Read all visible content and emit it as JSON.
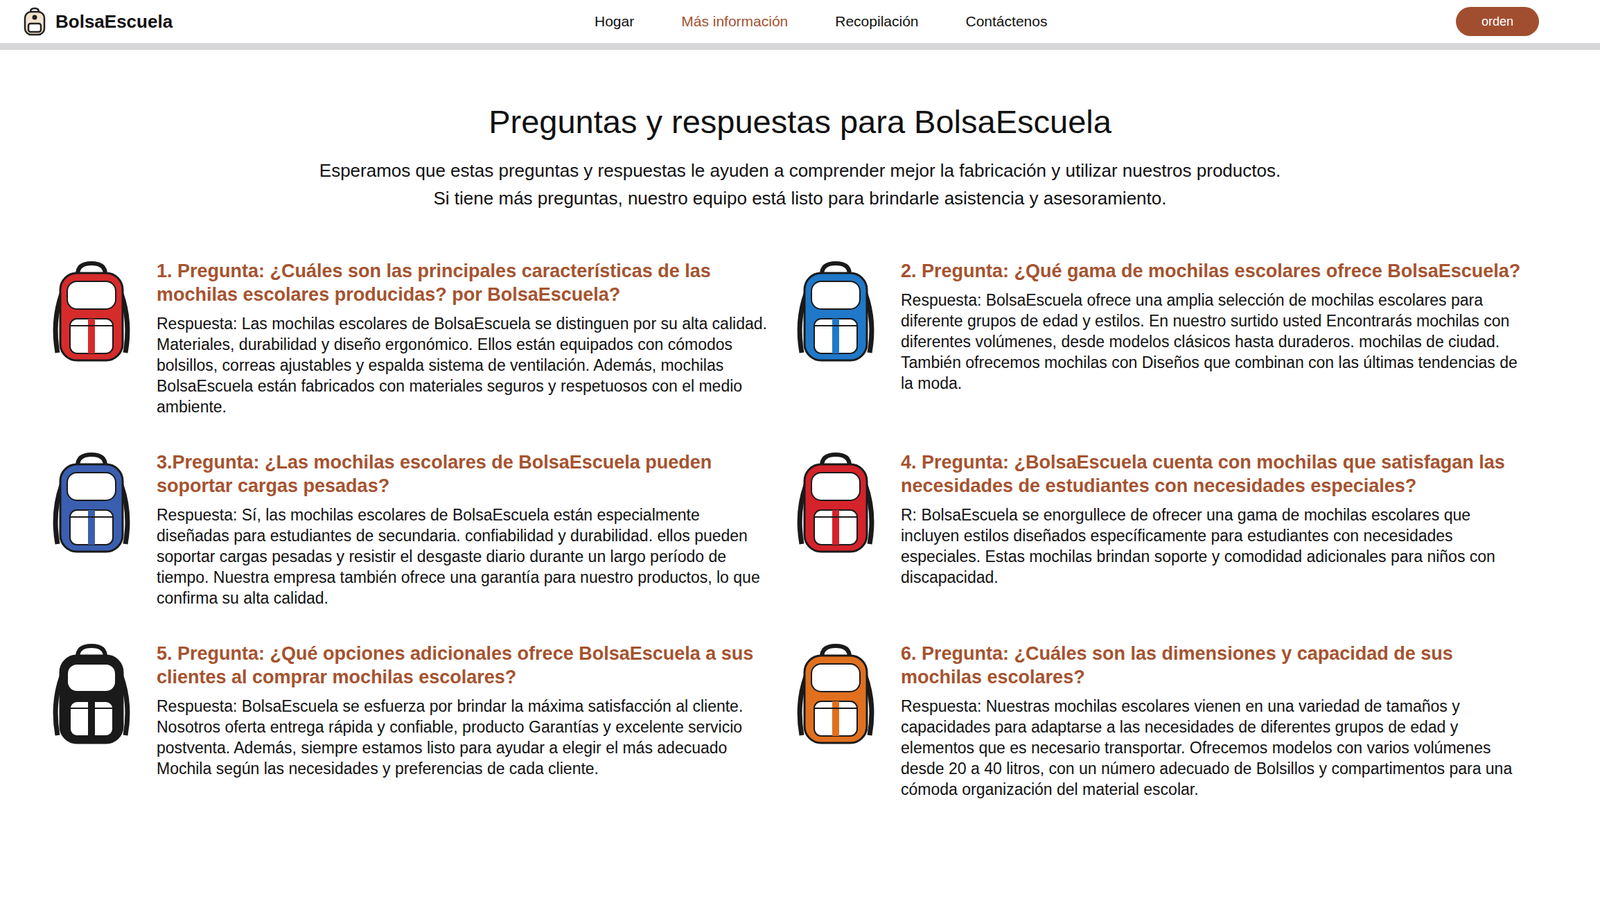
{
  "brand": {
    "name": "BolsaEscuela"
  },
  "nav": [
    {
      "label": "Hogar",
      "selected": false
    },
    {
      "label": "Más información",
      "selected": true
    },
    {
      "label": "Recopilación",
      "selected": false
    },
    {
      "label": "Contáctenos",
      "selected": false
    }
  ],
  "order_button": "orden",
  "page": {
    "title": "Preguntas y respuestas para BolsaEscuela",
    "intro": [
      "Esperamos que estas preguntas y respuestas le ayuden a comprender mejor la fabricación y utilizar nuestros productos.",
      "Si tiene más preguntas, nuestro equipo está listo para brindarle asistencia y asesoramiento."
    ]
  },
  "faq": [
    {
      "question": "1. Pregunta: ¿Cuáles son las principales características de las mochilas escolares producidas? por BolsaEscuela?",
      "answer": "Respuesta: Las mochilas escolares de BolsaEscuela se distinguen por su alta calidad. Materiales, durabilidad y diseño ergonómico. Ellos están equipados con cómodos bolsillos, correas ajustables y espalda sistema de ventilación. Además, mochilas BolsaEscuela están fabricados con materiales seguros y respetuosos con el medio ambiente.",
      "color": "#d62b2b"
    },
    {
      "question": "2. Pregunta: ¿Qué gama de mochilas escolares ofrece BolsaEscuela?",
      "answer": "Respuesta: BolsaEscuela ofrece una amplia selección de mochilas escolares para diferente grupos de edad y estilos. En nuestro surtido usted Encontrarás mochilas con diferentes volúmenes, desde modelos clásicos hasta duraderos. mochilas de ciudad. También ofrecemos mochilas con Diseños que combinan con las últimas tendencias de la moda.",
      "color": "#1f78c8"
    },
    {
      "question": "3.Pregunta: ¿Las mochilas escolares de BolsaEscuela pueden soportar cargas pesadas?",
      "answer": "Respuesta: Sí, las mochilas escolares de BolsaEscuela están especialmente diseñadas para estudiantes de secundaria. confiabilidad y durabilidad. ellos pueden soportar cargas pesadas y resistir el desgaste diario durante un largo período de tiempo. Nuestra empresa también ofrece una garantía para nuestro productos, lo que confirma su alta calidad.",
      "color": "#3a5fb0"
    },
    {
      "question": "4. Pregunta: ¿BolsaEscuela cuenta con mochilas que satisfagan las necesidades de estudiantes con necesidades especiales?",
      "answer": "R: BolsaEscuela se enorgullece de ofrecer una gama de mochilas escolares que incluyen estilos diseñados específicamente para estudiantes con necesidades especiales. Estas mochilas brindan soporte y comodidad adicionales para niños con discapacidad.",
      "color": "#d4232b"
    },
    {
      "question": "5. Pregunta: ¿Qué opciones adicionales ofrece BolsaEscuela a sus clientes al comprar mochilas escolares?",
      "answer": "Respuesta: BolsaEscuela se esfuerza por brindar la máxima satisfacción al cliente. Nosotros oferta entrega rápida y confiable, producto Garantías y excelente servicio postventa. Además, siempre estamos listo para ayudar a elegir el más adecuado Mochila según las necesidades y preferencias de cada cliente.",
      "color": "#1a1a1a"
    },
    {
      "question": "6. Pregunta: ¿Cuáles son las dimensiones y capacidad de sus mochilas escolares?",
      "answer": "Respuesta: Nuestras mochilas escolares vienen en una variedad de tamaños y capacidades para adaptarse a las necesidades de diferentes grupos de edad y elementos que es necesario transportar. Ofrecemos modelos con varios volúmenes desde 20 a 40 litros, con un número adecuado de Bolsillos y compartimentos para una cómoda organización del material escolar.",
      "color": "#e0701e"
    }
  ]
}
